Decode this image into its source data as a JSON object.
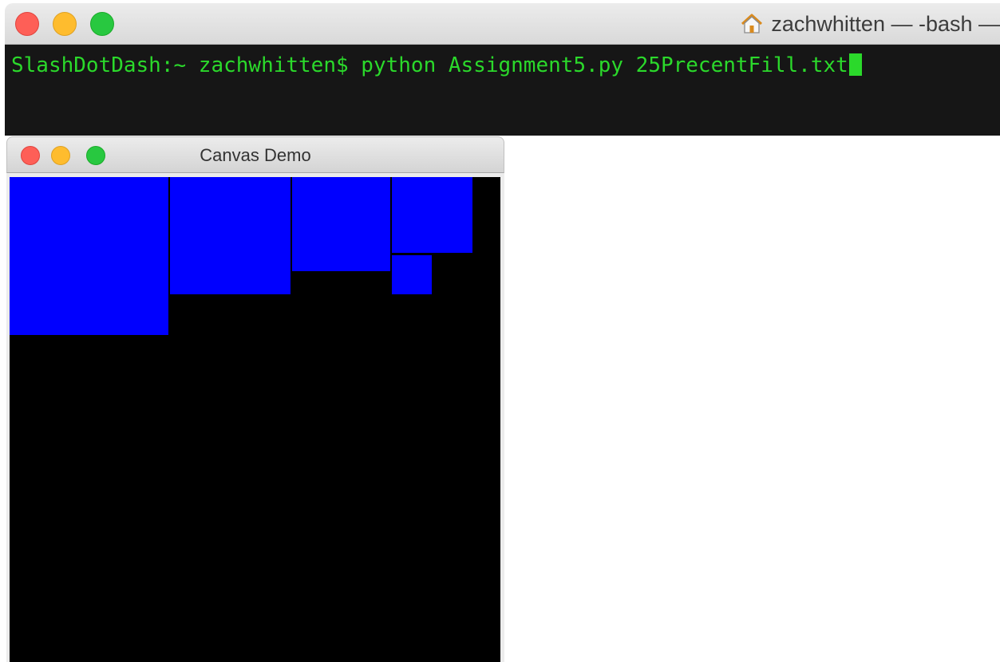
{
  "terminal": {
    "title": "zachwhitten — -bash —",
    "title_icon": "home-icon",
    "prompt": "SlashDotDash:~ zachwhitten$ ",
    "command": "python Assignment5.py 25PrecentFill.txt",
    "colors": {
      "text": "#2bd92b",
      "background": "#161616"
    }
  },
  "canvas_window": {
    "title": "Canvas Demo",
    "colors": {
      "background": "#000000",
      "fill": "#0000ff"
    }
  }
}
